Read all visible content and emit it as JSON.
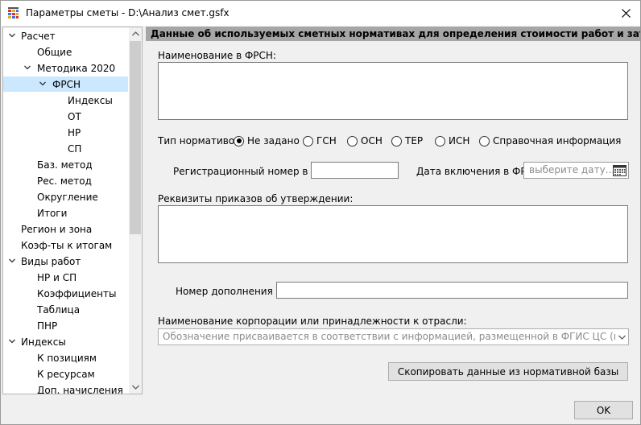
{
  "window": {
    "title": "Параметры сметы - D:\\Анализ смет.gsfx"
  },
  "tree": {
    "items": [
      {
        "label": "Расчет",
        "expanded": true
      },
      {
        "label": "Общие"
      },
      {
        "label": "Методика 2020",
        "expanded": true
      },
      {
        "label": "ФРСН",
        "expanded": true,
        "selected": true
      },
      {
        "label": "Индексы"
      },
      {
        "label": "ОТ"
      },
      {
        "label": "НР"
      },
      {
        "label": "СП"
      },
      {
        "label": "Баз. метод"
      },
      {
        "label": "Рес. метод"
      },
      {
        "label": "Округление"
      },
      {
        "label": "Итоги"
      },
      {
        "label": "Регион и зона"
      },
      {
        "label": "Коэф-ты к итогам"
      },
      {
        "label": "Виды работ",
        "expanded": true
      },
      {
        "label": "НР и СП"
      },
      {
        "label": "Коэффициенты"
      },
      {
        "label": "Таблица"
      },
      {
        "label": "ПНР"
      },
      {
        "label": "Индексы",
        "expanded": true
      },
      {
        "label": "К позициям"
      },
      {
        "label": "К ресурсам"
      },
      {
        "label": "Доп. начисления"
      }
    ]
  },
  "pane": {
    "header": "Данные об используемых сметных нормативах для определения стоимости работ и затрат",
    "name_label": "Наименование в ФРСН:",
    "name_value": "",
    "norm_type_label": "Тип нормативов:",
    "norm_types": [
      {
        "label": "Не задано",
        "checked": true
      },
      {
        "label": "ГСН",
        "checked": false
      },
      {
        "label": "ОСН",
        "checked": false
      },
      {
        "label": "ТЕР",
        "checked": false
      },
      {
        "label": "ИСН",
        "checked": false
      },
      {
        "label": "Справочная информация",
        "checked": false
      }
    ],
    "reg_number_label": "Регистрационный номер в ФРСН:",
    "reg_number_value": "",
    "date_label": "Дата включения в ФРСН:",
    "date_placeholder": "выберите дату...",
    "orders_label": "Реквизиты приказов об утверждении:",
    "orders_value": "",
    "snb_label": "Номер дополнения СНБ:",
    "snb_value": "",
    "corp_label": "Наименование корпорации или принадлежности к отрасли:",
    "corp_placeholder": "Обозначение присваивается в соответствии с информацией, размещенной в ФГИС ЦС (примечания в формах и",
    "copy_button": "Скопировать данные из нормативной базы"
  },
  "footer": {
    "ok_button": "OK"
  }
}
